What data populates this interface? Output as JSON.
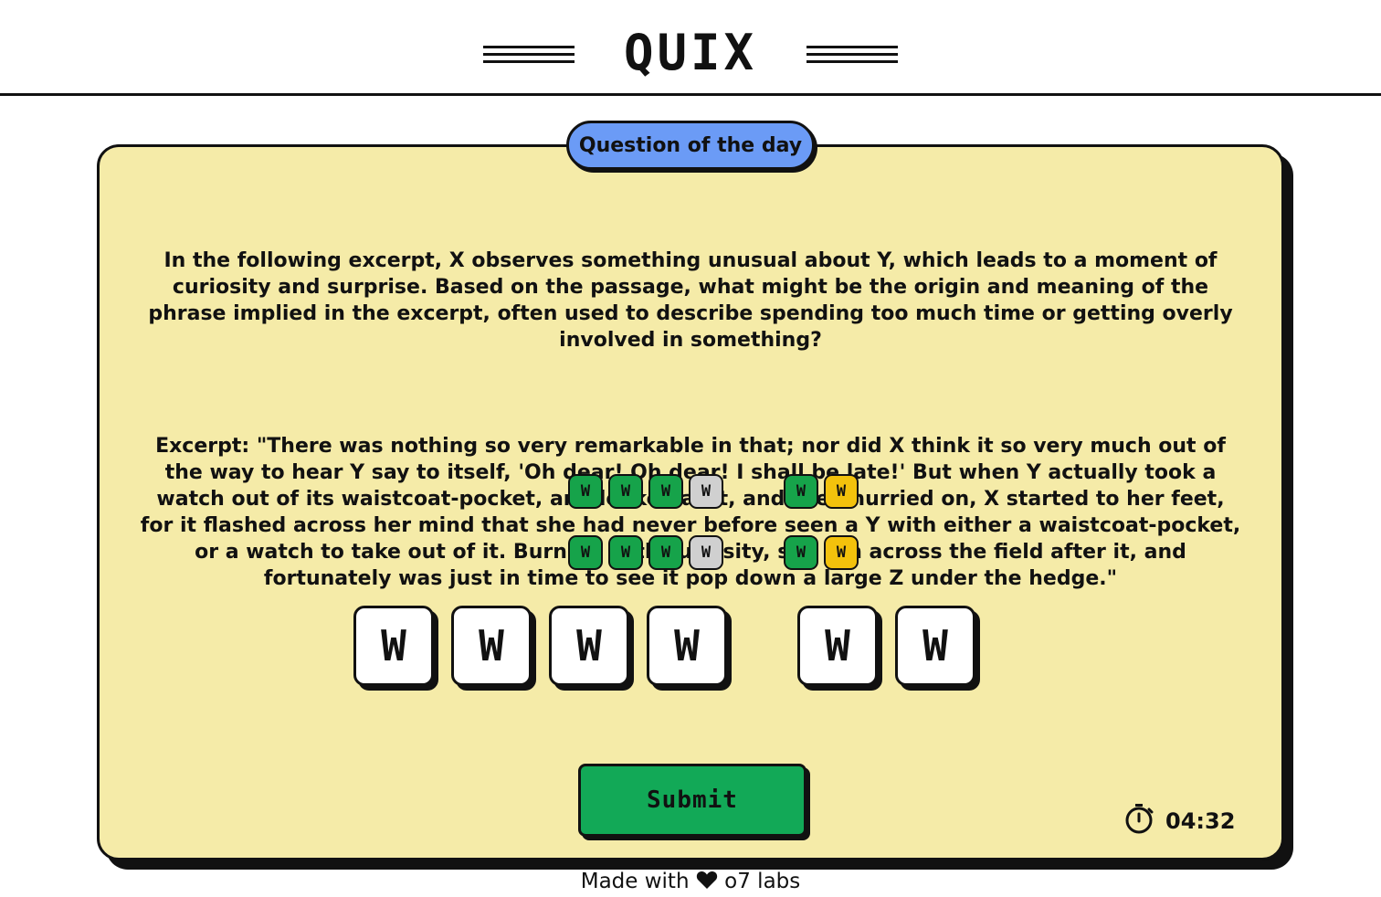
{
  "header": {
    "logo": "QUIX"
  },
  "card": {
    "badge": "Question of the day",
    "question": "In the following excerpt, X observes something unusual about Y, which leads to a moment of curiosity and surprise. Based on the passage, what might be the origin and meaning of the phrase implied in the excerpt, often used to describe spending too much time or getting overly involved in something?",
    "excerpt": "Excerpt: \"There was nothing so very remarkable in that; nor did X think it so very much out of the way to hear Y say to itself, 'Oh dear! Oh dear! I shall be late!' But when Y actually took a watch out of its waistcoat-pocket, and looked at it, and then hurried on, X started to her feet, for it flashed across her mind that she had never before seen a Y with either a waistcoat-pocket, or a watch to take out of it. Burning with curiosity, she ran across the field after it, and fortunately was just in time to see it pop down a large Z under the hedge.\""
  },
  "hints": {
    "rows": [
      {
        "groups": [
          [
            {
              "letter": "W",
              "state": "correct"
            },
            {
              "letter": "W",
              "state": "correct"
            },
            {
              "letter": "W",
              "state": "correct"
            },
            {
              "letter": "W",
              "state": "absent"
            }
          ],
          [
            {
              "letter": "W",
              "state": "correct"
            },
            {
              "letter": "W",
              "state": "present"
            }
          ]
        ]
      },
      {
        "groups": [
          [
            {
              "letter": "W",
              "state": "correct"
            },
            {
              "letter": "W",
              "state": "correct"
            },
            {
              "letter": "W",
              "state": "correct"
            },
            {
              "letter": "W",
              "state": "absent"
            }
          ],
          [
            {
              "letter": "W",
              "state": "correct"
            },
            {
              "letter": "W",
              "state": "present"
            }
          ]
        ]
      }
    ],
    "colors": {
      "correct": "#16a34a",
      "present": "#f3c20c",
      "absent": "#d0d0d0"
    }
  },
  "answer": {
    "groups": [
      [
        "W",
        "W",
        "W",
        "W"
      ],
      [
        "W",
        "W"
      ]
    ]
  },
  "submit_label": "Submit",
  "timer": {
    "value": "04:32",
    "icon": "stopwatch-icon"
  },
  "footer": {
    "before": "Made with",
    "icon": "heart-icon",
    "after": "o7 labs"
  },
  "colors": {
    "card": "#f5eba8",
    "badge": "#6b9bf6",
    "submit": "#12a957"
  }
}
